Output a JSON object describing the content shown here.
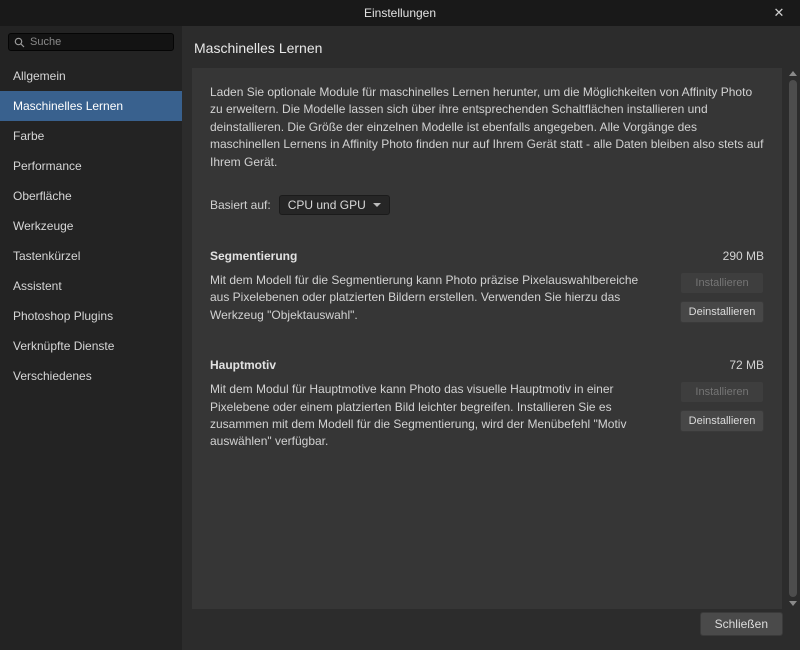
{
  "window": {
    "title": "Einstellungen",
    "close_icon": "✕"
  },
  "colors": {
    "selected_item": "#39618e",
    "panel_bg": "#363636",
    "titlebar_bg": "#191919"
  },
  "sidebar": {
    "search_placeholder": "Suche",
    "items": [
      {
        "label": "Allgemein",
        "selected": false
      },
      {
        "label": "Maschinelles Lernen",
        "selected": true
      },
      {
        "label": "Farbe",
        "selected": false
      },
      {
        "label": "Performance",
        "selected": false
      },
      {
        "label": "Oberfläche",
        "selected": false
      },
      {
        "label": "Werkzeuge",
        "selected": false
      },
      {
        "label": "Tastenkürzel",
        "selected": false
      },
      {
        "label": "Assistent",
        "selected": false
      },
      {
        "label": "Photoshop Plugins",
        "selected": false
      },
      {
        "label": "Verknüpfte Dienste",
        "selected": false
      },
      {
        "label": "Verschiedenes",
        "selected": false
      }
    ]
  },
  "main": {
    "title": "Maschinelles Lernen",
    "intro": "Laden Sie optionale Module für maschinelles Lernen herunter, um die Möglichkeiten von Affinity Photo zu erweitern. Die Modelle lassen sich über ihre entsprechenden Schaltflächen installieren und deinstallieren. Die Größe der einzelnen Modelle ist ebenfalls angegeben. Alle Vorgänge des maschinellen Lernens in Affinity Photo finden nur auf Ihrem Gerät statt - alle Daten bleiben also stets auf Ihrem Gerät.",
    "based_on_label": "Basiert auf:",
    "based_on_value": "CPU und GPU",
    "sections": [
      {
        "title": "Segmentierung",
        "size": "290 MB",
        "description": "Mit dem Modell für die Segmentierung kann Photo präzise Pixelauswahlbereiche aus Pixelebenen oder platzierten Bildern erstellen. Verwenden Sie hierzu das Werkzeug \"Objektauswahl\".",
        "install_label": "Installieren",
        "uninstall_label": "Deinstallieren"
      },
      {
        "title": "Hauptmotiv",
        "size": "72 MB",
        "description": "Mit dem Modul für Hauptmotive kann Photo das visuelle Hauptmotiv in einer Pixelebene oder einem platzierten Bild leichter begreifen. Installieren Sie es zusammen mit dem Modell für die Segmentierung, wird der Menübefehl \"Motiv auswählen\" verfügbar.",
        "install_label": "Installieren",
        "uninstall_label": "Deinstallieren"
      }
    ]
  },
  "footer": {
    "close_label": "Schließen"
  }
}
